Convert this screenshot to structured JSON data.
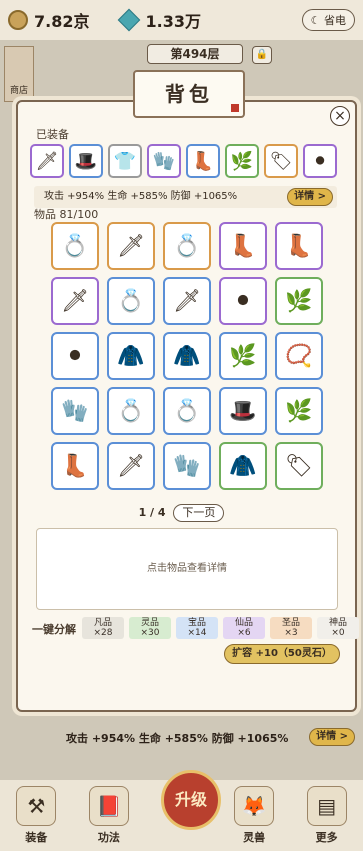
{
  "topbar": {
    "gold": "7.82京",
    "spirit": "1.33万",
    "mode_label": "省电"
  },
  "background": {
    "floor": "第494层",
    "lock": "🔒",
    "shop": "商店",
    "stats": "攻击 +954%  生命 +585%  防御 +1065%",
    "detail_label": "详情 >"
  },
  "dialog": {
    "title": "背包",
    "equipped_label": "已装备",
    "equipped": [
      {
        "icon": "🗡",
        "quality": "purple"
      },
      {
        "icon": "🎩",
        "quality": "blue"
      },
      {
        "icon": "👕",
        "quality": "gray"
      },
      {
        "icon": "🧤",
        "quality": "purple"
      },
      {
        "icon": "👢",
        "quality": "blue"
      },
      {
        "icon": "🌿",
        "quality": "green"
      },
      {
        "icon": "🏷",
        "quality": "orange"
      },
      {
        "icon": "⚫",
        "quality": "purple"
      }
    ],
    "stats": "攻击 +954%  生命 +585%  防御 +1065%",
    "detail_label": "详情 >",
    "items_label": "物品 81/100",
    "items": [
      {
        "icon": "💍",
        "quality": "orange"
      },
      {
        "icon": "🗡",
        "quality": "orange"
      },
      {
        "icon": "💍",
        "quality": "orange"
      },
      {
        "icon": "👢",
        "quality": "purple"
      },
      {
        "icon": "👢",
        "quality": "purple"
      },
      {
        "icon": "🗡",
        "quality": "purple"
      },
      {
        "icon": "💍",
        "quality": "blue"
      },
      {
        "icon": "🗡",
        "quality": "blue"
      },
      {
        "icon": "⚫",
        "quality": "purple"
      },
      {
        "icon": "🌿",
        "quality": "green"
      },
      {
        "icon": "⚫",
        "quality": "blue"
      },
      {
        "icon": "🧥",
        "quality": "blue"
      },
      {
        "icon": "🧥",
        "quality": "blue"
      },
      {
        "icon": "🌿",
        "quality": "blue"
      },
      {
        "icon": "📿",
        "quality": "blue"
      },
      {
        "icon": "🧤",
        "quality": "blue"
      },
      {
        "icon": "💍",
        "quality": "blue"
      },
      {
        "icon": "💍",
        "quality": "blue"
      },
      {
        "icon": "🎩",
        "quality": "blue"
      },
      {
        "icon": "🌿",
        "quality": "blue"
      },
      {
        "icon": "👢",
        "quality": "blue"
      },
      {
        "icon": "🗡",
        "quality": "blue"
      },
      {
        "icon": "🧤",
        "quality": "blue"
      },
      {
        "icon": "🧥",
        "quality": "green"
      },
      {
        "icon": "🏷",
        "quality": "green"
      }
    ],
    "page": "1 / 4",
    "next_label": "下一页",
    "info_placeholder": "点击物品查看详情",
    "decompose_label": "一键分解",
    "decompose": [
      {
        "name": "凡品",
        "count": "×28",
        "bg": "#e7e4dc"
      },
      {
        "name": "灵品",
        "count": "×30",
        "bg": "#d7ecd0"
      },
      {
        "name": "宝品",
        "count": "×14",
        "bg": "#d4e3f6"
      },
      {
        "name": "仙品",
        "count": "×6",
        "bg": "#e4d6f3"
      },
      {
        "name": "圣品",
        "count": "×3",
        "bg": "#f6dcc1"
      },
      {
        "name": "神品",
        "count": "×0",
        "bg": "#f1efea"
      }
    ],
    "expand_label": "扩容 +10（50灵石）"
  },
  "nav": {
    "upgrade": "升级",
    "items": [
      {
        "label": "装备",
        "icon": "⚒"
      },
      {
        "label": "功法",
        "icon": "📕"
      },
      {
        "label": "灵兽",
        "icon": "🦊"
      },
      {
        "label": "更多",
        "icon": "▤"
      }
    ]
  }
}
